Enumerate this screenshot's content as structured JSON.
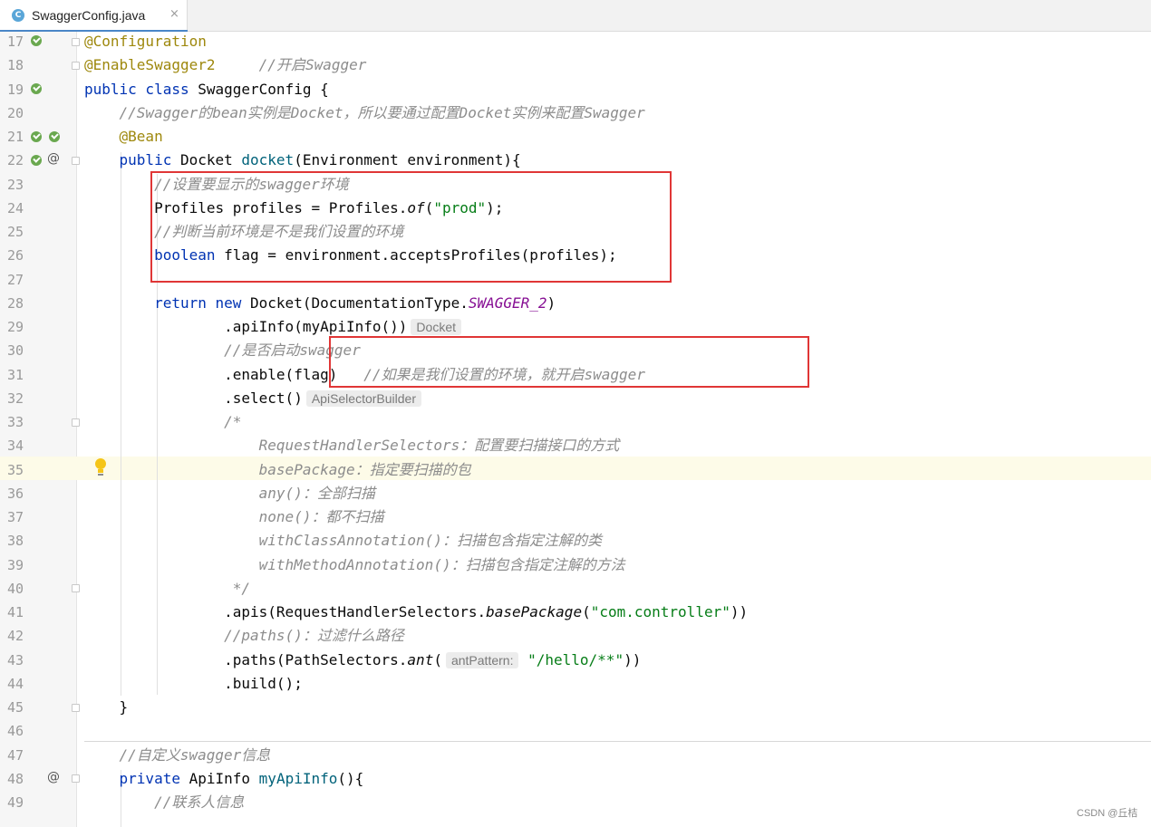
{
  "tab": {
    "icon_letter": "C",
    "title": "SwaggerConfig.java",
    "close": "×"
  },
  "watermark": "CSDN @丘桔",
  "gutter_icons": {
    "bean_icon": "bean-icon",
    "override_icon": "override-icon",
    "implemented_icon": "implemented-icon",
    "intention_icon": "lightbulb-icon"
  },
  "editor": {
    "lines": [
      {
        "n": "17",
        "t": [
          [
            "@Configuration",
            "ann"
          ]
        ]
      },
      {
        "n": "18",
        "t": [
          [
            "@EnableSwagger2",
            "ann"
          ],
          [
            "     ",
            ""
          ],
          [
            "//开启Swagger",
            "cm"
          ]
        ]
      },
      {
        "n": "19",
        "t": [
          [
            "public class",
            "kw"
          ],
          [
            " SwaggerConfig {",
            ""
          ]
        ]
      },
      {
        "n": "20",
        "t": [
          [
            "    ",
            ""
          ],
          [
            "//Swagger的bean实例是Docket，所以要通过配置Docket实例来配置Swagger",
            "cm"
          ]
        ]
      },
      {
        "n": "21",
        "t": [
          [
            "    ",
            ""
          ],
          [
            "@Bean",
            "ann"
          ]
        ]
      },
      {
        "n": "22",
        "t": [
          [
            "    ",
            ""
          ],
          [
            "public",
            "kw"
          ],
          [
            " Docket ",
            ""
          ],
          [
            "docket",
            "fn"
          ],
          [
            "(Environment environment){",
            ""
          ]
        ]
      },
      {
        "n": "23",
        "t": [
          [
            "        ",
            ""
          ],
          [
            "//设置要显示的swagger环境",
            "cm"
          ]
        ]
      },
      {
        "n": "24",
        "t": [
          [
            "        Profiles profiles = Profiles.",
            ""
          ],
          [
            "of",
            "st"
          ],
          [
            "(",
            ""
          ],
          [
            "\"prod\"",
            "str"
          ],
          [
            ");",
            ""
          ]
        ]
      },
      {
        "n": "25",
        "t": [
          [
            "        ",
            ""
          ],
          [
            "//判断当前环境是不是我们设置的环境",
            "cm"
          ]
        ]
      },
      {
        "n": "26",
        "t": [
          [
            "        ",
            ""
          ],
          [
            "boolean",
            "kw"
          ],
          [
            " flag = environment.acceptsProfiles(profiles);",
            ""
          ]
        ]
      },
      {
        "n": "27",
        "t": []
      },
      {
        "n": "28",
        "t": [
          [
            "        ",
            ""
          ],
          [
            "return new",
            "kw"
          ],
          [
            " Docket(DocumentationType.",
            ""
          ],
          [
            "SWAGGER_2",
            "cst"
          ],
          [
            ")",
            ""
          ]
        ]
      },
      {
        "n": "29",
        "t": [
          [
            "                ",
            ""
          ],
          [
            ".apiInfo(myApiInfo())",
            ""
          ],
          [
            "Docket",
            "hint"
          ]
        ]
      },
      {
        "n": "30",
        "t": [
          [
            "                ",
            ""
          ],
          [
            "//是否启动swagger",
            "cm"
          ]
        ]
      },
      {
        "n": "31",
        "t": [
          [
            "                ",
            ""
          ],
          [
            ".enable(flag)   ",
            ""
          ],
          [
            "//如果是我们设置的环境，就开启swagger",
            "cm"
          ]
        ]
      },
      {
        "n": "32",
        "t": [
          [
            "                ",
            ""
          ],
          [
            ".select()",
            ""
          ],
          [
            "ApiSelectorBuilder",
            "hint"
          ]
        ]
      },
      {
        "n": "33",
        "t": [
          [
            "                ",
            ""
          ],
          [
            "/*",
            "cm"
          ]
        ]
      },
      {
        "n": "34",
        "t": [
          [
            "                    ",
            ""
          ],
          [
            "RequestHandlerSelectors：配置要扫描接口的方式",
            "cm"
          ]
        ]
      },
      {
        "n": "35",
        "t": [
          [
            "                    ",
            ""
          ],
          [
            "basePackage：指定要扫描的包",
            "cm"
          ]
        ]
      },
      {
        "n": "36",
        "t": [
          [
            "                    ",
            ""
          ],
          [
            "any()：全部扫描",
            "cm"
          ]
        ]
      },
      {
        "n": "37",
        "t": [
          [
            "                    ",
            ""
          ],
          [
            "none()：都不扫描",
            "cm"
          ]
        ]
      },
      {
        "n": "38",
        "t": [
          [
            "                    ",
            ""
          ],
          [
            "withClassAnnotation()：扫描包含指定注解的类",
            "cm"
          ]
        ]
      },
      {
        "n": "39",
        "t": [
          [
            "                    ",
            ""
          ],
          [
            "withMethodAnnotation()：扫描包含指定注解的方法",
            "cm"
          ]
        ]
      },
      {
        "n": "40",
        "t": [
          [
            "                 ",
            ""
          ],
          [
            "*/",
            "cm"
          ]
        ]
      },
      {
        "n": "41",
        "t": [
          [
            "                ",
            ""
          ],
          [
            ".apis(RequestHandlerSelectors.",
            ""
          ],
          [
            "basePackage",
            "st"
          ],
          [
            "(",
            ""
          ],
          [
            "\"com.controller\"",
            "str"
          ],
          [
            "))",
            ""
          ]
        ]
      },
      {
        "n": "42",
        "t": [
          [
            "                ",
            ""
          ],
          [
            "//paths()：过滤什么路径",
            "cm"
          ]
        ]
      },
      {
        "n": "43",
        "t": [
          [
            "                ",
            ""
          ],
          [
            ".paths(PathSelectors.",
            ""
          ],
          [
            "ant",
            "st"
          ],
          [
            "(",
            ""
          ],
          [
            "antPattern:",
            "hint"
          ],
          [
            " ",
            ""
          ],
          [
            "\"/hello/**\"",
            "str"
          ],
          [
            "))",
            ""
          ]
        ]
      },
      {
        "n": "44",
        "t": [
          [
            "                ",
            ""
          ],
          [
            ".build();",
            ""
          ]
        ]
      },
      {
        "n": "45",
        "t": [
          [
            "    }",
            ""
          ]
        ]
      },
      {
        "n": "46",
        "t": []
      },
      {
        "n": "47",
        "t": [
          [
            "    ",
            ""
          ],
          [
            "//自定义swagger信息",
            "cm"
          ]
        ]
      },
      {
        "n": "48",
        "t": [
          [
            "    ",
            ""
          ],
          [
            "private",
            "kw"
          ],
          [
            " ApiInfo ",
            ""
          ],
          [
            "myApiInfo",
            "fn"
          ],
          [
            "(){",
            ""
          ]
        ]
      },
      {
        "n": "49",
        "t": [
          [
            "        ",
            ""
          ],
          [
            "//联系人信息",
            "cm"
          ]
        ]
      }
    ]
  }
}
